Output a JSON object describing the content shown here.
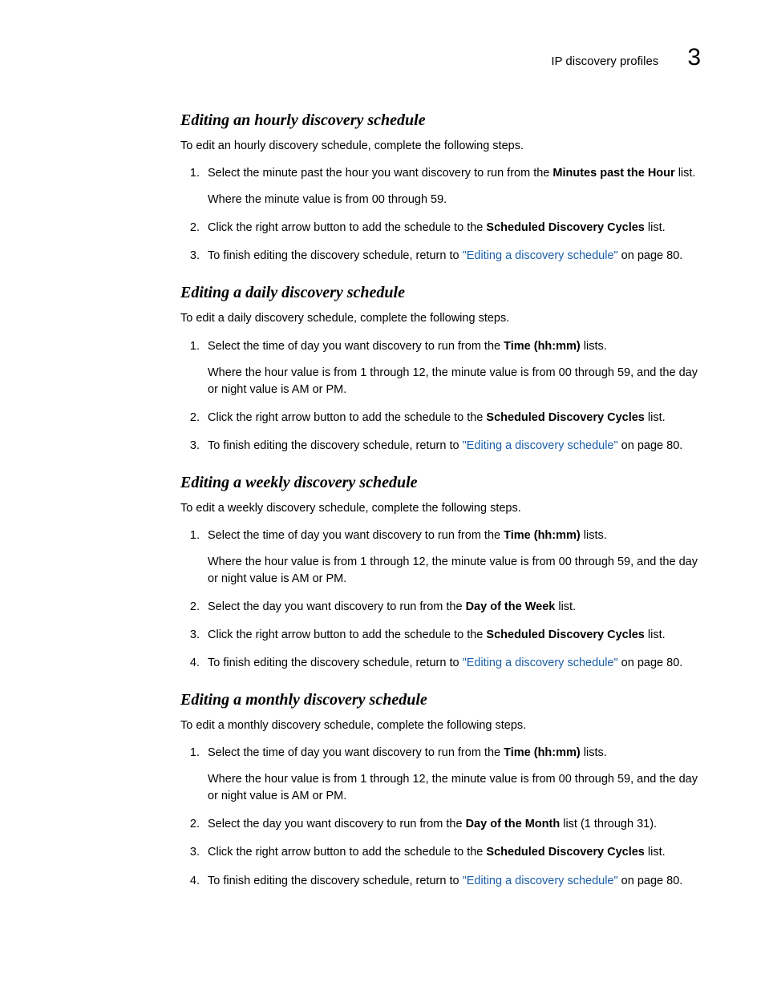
{
  "header": {
    "title": "IP discovery profiles",
    "chapter": "3"
  },
  "link_text": "\"Editing a discovery schedule\"",
  "sections": [
    {
      "heading": "Editing an hourly discovery schedule",
      "intro": "To edit an hourly discovery schedule, complete the following steps.",
      "steps": [
        {
          "pre": "Select the minute past the hour you want discovery to run from the ",
          "bold": "Minutes past the Hour",
          "post": " list.",
          "note": "Where the minute value is from 00 through 59."
        },
        {
          "pre": "Click the right arrow button to add the schedule to the ",
          "bold": "Scheduled Discovery Cycles",
          "post": " list."
        },
        {
          "pre": "To finish editing the discovery schedule, return to ",
          "link": true,
          "post": " on page 80."
        }
      ]
    },
    {
      "heading": "Editing a daily discovery schedule",
      "intro": "To edit a daily discovery schedule, complete the following steps.",
      "steps": [
        {
          "pre": "Select the time of day you want discovery to run from the ",
          "bold": "Time (hh:mm)",
          "post": " lists.",
          "note": "Where the hour value is from 1 through 12, the minute value is from 00 through 59, and the day or night value is AM or PM."
        },
        {
          "pre": "Click the right arrow button to add the schedule to the ",
          "bold": "Scheduled Discovery Cycles",
          "post": " list."
        },
        {
          "pre": "To finish editing the discovery schedule, return to ",
          "link": true,
          "post": " on page 80."
        }
      ]
    },
    {
      "heading": "Editing a weekly discovery schedule",
      "intro": "To edit a weekly discovery schedule, complete the following steps.",
      "steps": [
        {
          "pre": "Select the time of day you want discovery to run from the ",
          "bold": "Time (hh:mm)",
          "post": " lists.",
          "note": "Where the hour value is from 1 through 12, the minute value is from 00 through 59, and the day or night value is AM or PM."
        },
        {
          "pre": "Select the day you want discovery to run from the ",
          "bold": "Day of the Week",
          "post": " list."
        },
        {
          "pre": "Click the right arrow button to add the schedule to the ",
          "bold": "Scheduled Discovery Cycles",
          "post": " list."
        },
        {
          "pre": "To finish editing the discovery schedule, return to ",
          "link": true,
          "post": " on page 80."
        }
      ]
    },
    {
      "heading": "Editing a monthly discovery schedule",
      "intro": "To edit a monthly discovery schedule, complete the following steps.",
      "steps": [
        {
          "pre": "Select the time of day you want discovery to run from the ",
          "bold": "Time (hh:mm)",
          "post": " lists.",
          "note": "Where the hour value is from 1 through 12, the minute value is from 00 through 59, and the day or night value is AM or PM."
        },
        {
          "pre": "Select the day you want discovery to run from the ",
          "bold": "Day of the Month",
          "post": " list (1 through 31)."
        },
        {
          "pre": "Click the right arrow button to add the schedule to the ",
          "bold": "Scheduled Discovery Cycles",
          "post": " list."
        },
        {
          "pre": "To finish editing the discovery schedule, return to ",
          "link": true,
          "post": " on page 80."
        }
      ]
    }
  ]
}
